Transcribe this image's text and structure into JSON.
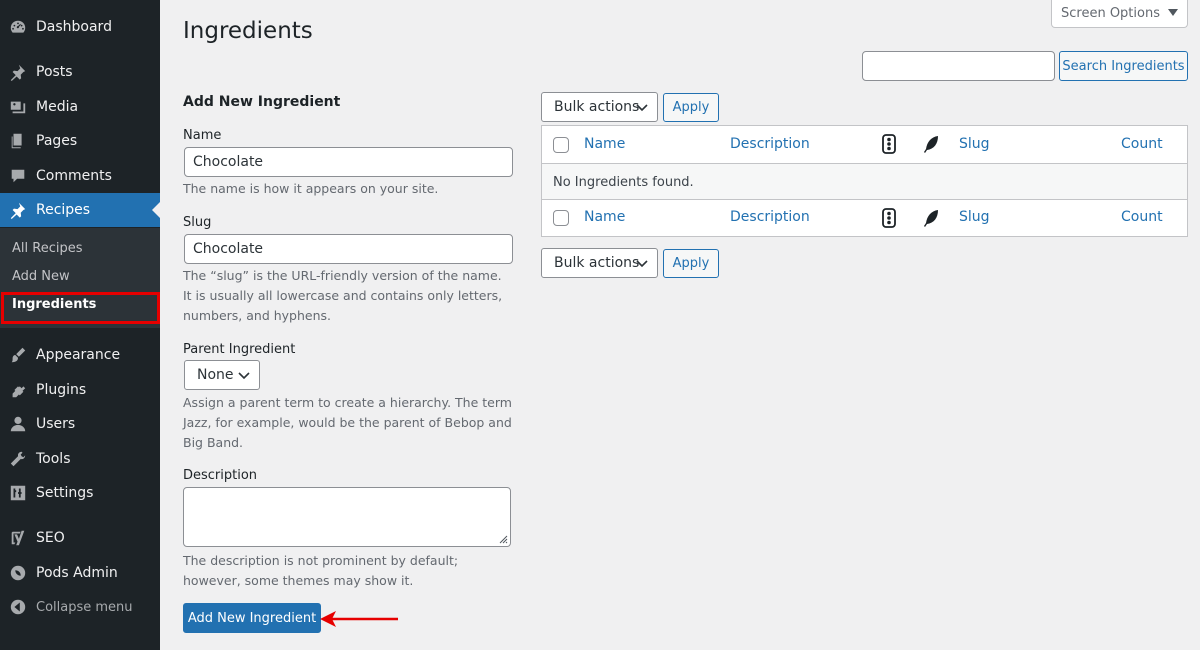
{
  "sidebar": {
    "items": [
      {
        "label": "Dashboard",
        "icon": "dashboard-icon"
      },
      {
        "label": "Posts",
        "icon": "pin-icon"
      },
      {
        "label": "Media",
        "icon": "media-icon"
      },
      {
        "label": "Pages",
        "icon": "pages-icon"
      },
      {
        "label": "Comments",
        "icon": "comment-icon"
      },
      {
        "label": "Recipes",
        "icon": "pin-icon",
        "active": true
      },
      {
        "label": "Appearance",
        "icon": "brush-icon"
      },
      {
        "label": "Plugins",
        "icon": "plug-icon"
      },
      {
        "label": "Users",
        "icon": "user-icon"
      },
      {
        "label": "Tools",
        "icon": "wrench-icon"
      },
      {
        "label": "Settings",
        "icon": "settings-icon"
      },
      {
        "label": "SEO",
        "icon": "yoast-icon"
      },
      {
        "label": "Pods Admin",
        "icon": "pods-icon"
      }
    ],
    "submenu": [
      "All Recipes",
      "Add New",
      "Ingredients"
    ],
    "collapse_label": "Collapse menu"
  },
  "header": {
    "title": "Ingredients",
    "screen_options": "Screen Options",
    "search_button": "Search Ingredients",
    "search_value": ""
  },
  "form": {
    "heading": "Add New Ingredient",
    "name_label": "Name",
    "name_value": "Chocolate",
    "name_help": "The name is how it appears on your site.",
    "slug_label": "Slug",
    "slug_value": "Chocolate",
    "slug_help": "The “slug” is the URL-friendly version of the name. It is usually all lowercase and contains only letters, numbers, and hyphens.",
    "parent_label": "Parent Ingredient",
    "parent_value": "None",
    "parent_help": "Assign a parent term to create a hierarchy. The term Jazz, for example, would be the parent of Bebop and Big Band.",
    "description_label": "Description",
    "description_value": "",
    "description_help": "The description is not prominent by default; however, some themes may show it.",
    "submit_label": "Add New Ingredient"
  },
  "table": {
    "bulk_actions": "Bulk actions",
    "apply": "Apply",
    "columns": {
      "name": "Name",
      "description": "Description",
      "slug": "Slug",
      "count": "Count"
    },
    "empty_message": "No Ingredients found."
  },
  "colors": {
    "sidebar_bg": "#1d2327",
    "accent": "#2271b1",
    "highlight": "#e60000"
  }
}
